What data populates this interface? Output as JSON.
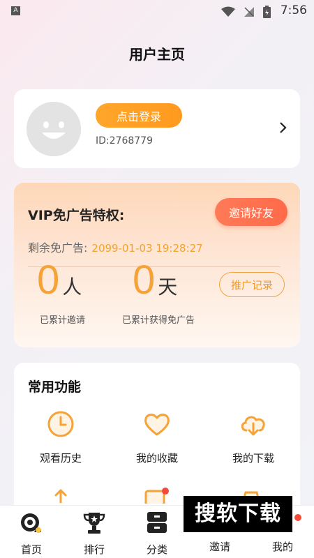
{
  "status_bar": {
    "app_letter": "A",
    "time": "7:56"
  },
  "page_title": "用户主页",
  "profile": {
    "login_label": "点击登录",
    "user_id": "ID:2768779"
  },
  "vip": {
    "title": "VIP免广告特权:",
    "invite_label": "邀请好友",
    "remaining_label": "剩余免广告:",
    "remaining_value": "2099-01-03 19:28:27",
    "invites_count": "0",
    "invites_unit": "人",
    "invites_label": "已累计邀请",
    "days_count": "0",
    "days_unit": "天",
    "days_label": "已累计获得免广告",
    "records_label": "推广记录"
  },
  "functions": {
    "title": "常用功能",
    "items": [
      {
        "label": "观看历史",
        "icon": "clock-icon"
      },
      {
        "label": "我的收藏",
        "icon": "heart-icon"
      },
      {
        "label": "我的下载",
        "icon": "cloud-download-icon"
      }
    ]
  },
  "tabs": [
    {
      "label": "首页",
      "icon": "home-icon"
    },
    {
      "label": "排行",
      "icon": "trophy-icon"
    },
    {
      "label": "分类",
      "icon": "category-icon"
    },
    {
      "label": "邀请",
      "icon": "invite-icon"
    },
    {
      "label": "我的",
      "icon": "profile-icon"
    }
  ],
  "watermark": "搜软下载",
  "colors": {
    "accent_orange": "#F7A236",
    "invite_red": "#FF6E4E",
    "badge_red": "#F24B3A"
  }
}
